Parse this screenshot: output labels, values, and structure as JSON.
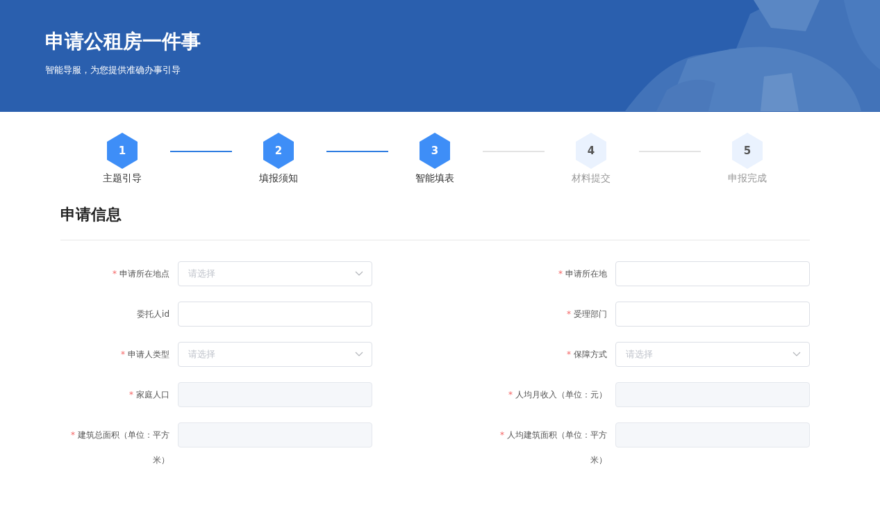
{
  "header": {
    "title": "申请公租房一件事",
    "subtitle": "智能导服，为您提供准确办事引导",
    "kind": "picture"
  },
  "steps": [
    {
      "number": "1",
      "label": "主题引导",
      "done": true
    },
    {
      "number": "2",
      "label": "填报须知",
      "done": true
    },
    {
      "number": "3",
      "label": "智能填表",
      "done": true
    },
    {
      "number": "4",
      "label": "材料提交",
      "done": false
    },
    {
      "number": "5",
      "label": "申报完成",
      "done": false
    }
  ],
  "section": {
    "title": "申请信息"
  },
  "fields": [
    {
      "label": "申请所在地点",
      "required_mark": "*",
      "kind": "select",
      "placeholder": "请选择"
    },
    {
      "label": "申请所在地",
      "required_mark": "*",
      "kind": "text"
    },
    {
      "label": "委托人id",
      "kind": "text"
    },
    {
      "label": "受理部门",
      "required_mark": "*",
      "kind": "text"
    },
    {
      "label": "申请人类型",
      "required_mark": "*",
      "kind": "select",
      "placeholder": "请选择"
    },
    {
      "label": "保障方式",
      "required_mark": "*",
      "kind": "select",
      "placeholder": "请选择"
    },
    {
      "label": "家庭人口",
      "required_mark": "*",
      "kind": "disabled"
    },
    {
      "label": "人均月收入（单位：元）",
      "required_mark": "*",
      "kind": "disabled"
    },
    {
      "label": "建筑总面积（单位：平方米）",
      "required_mark": "*",
      "kind": "disabled"
    },
    {
      "label": "人均建筑面积（单位：平方米）",
      "required_mark": "*",
      "kind": "disabled"
    }
  ]
}
